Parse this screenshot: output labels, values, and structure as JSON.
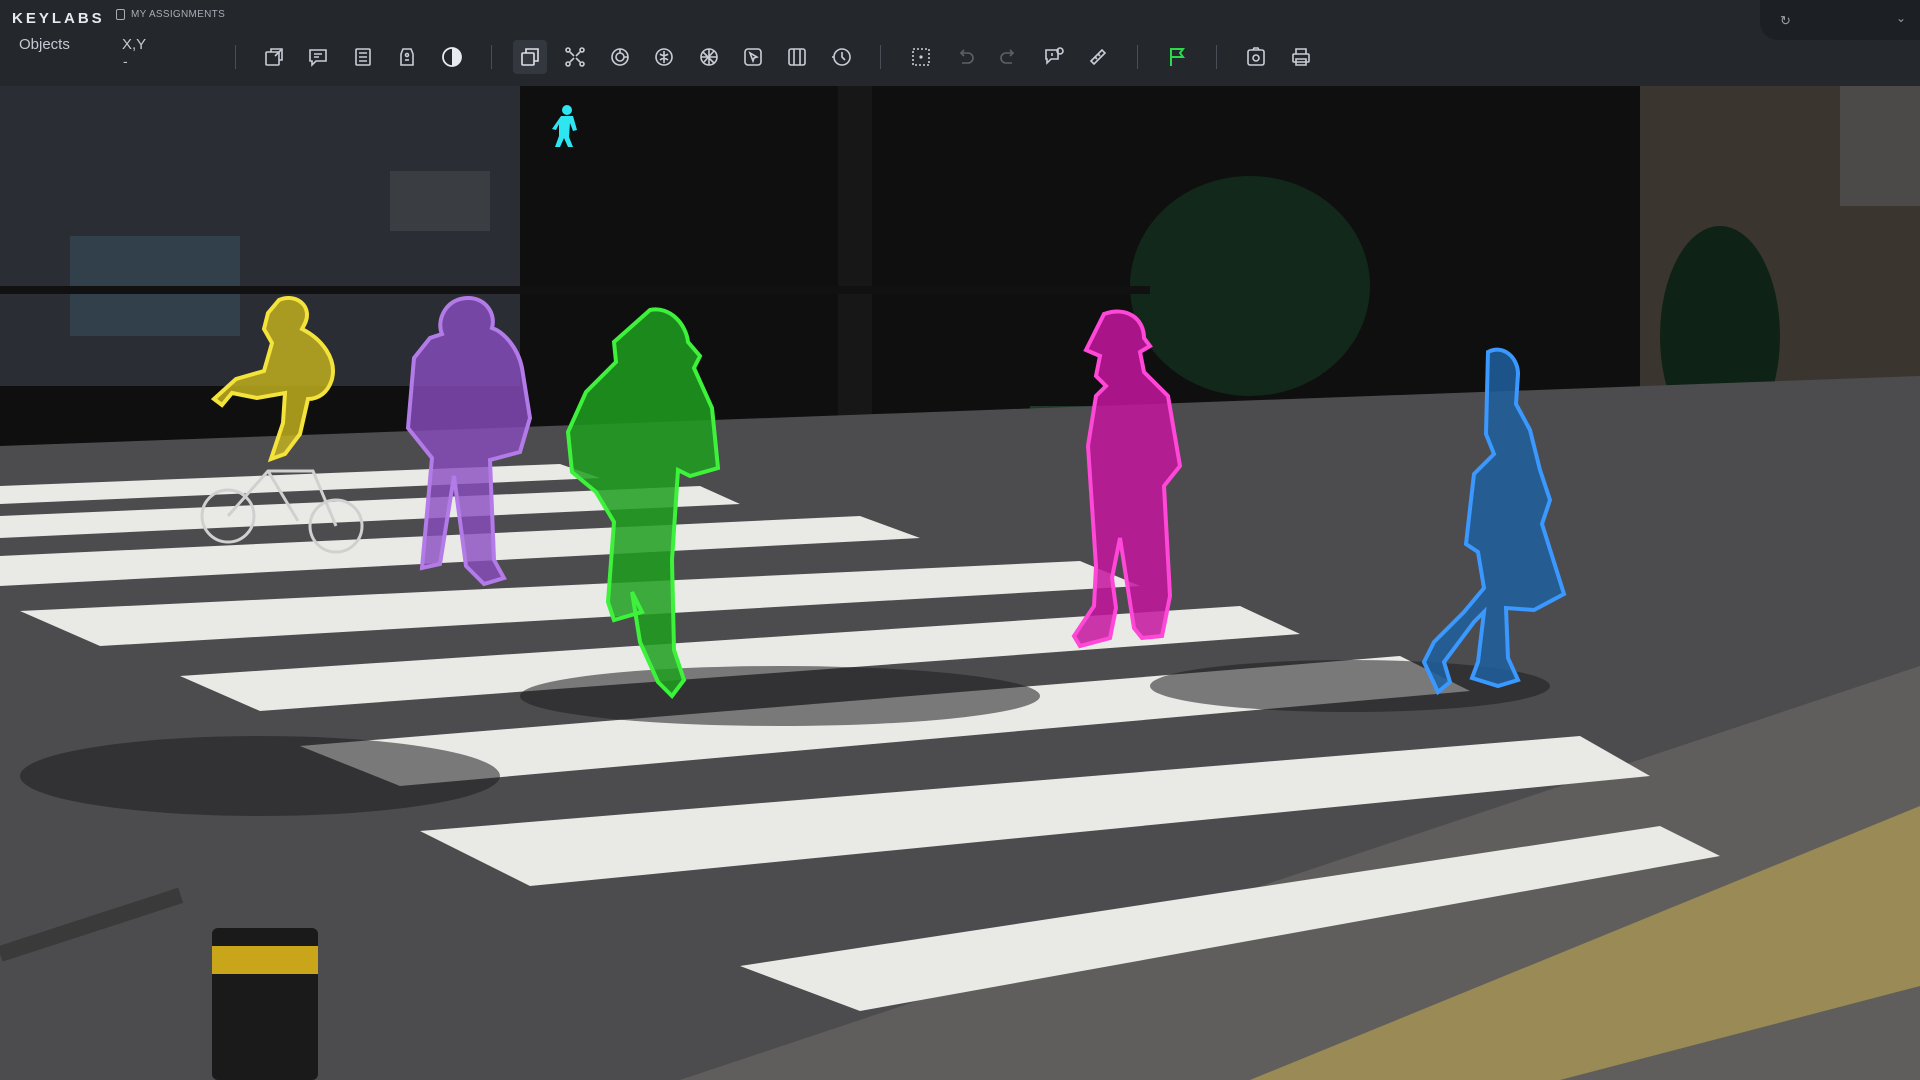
{
  "app": {
    "brand": "KEYLABS",
    "assignments_label": "MY ASSIGNMENTS"
  },
  "info": {
    "objects_label": "Objects",
    "xy_label": "X,Y",
    "xy_value": "-"
  },
  "toolbar": {
    "tools": [
      {
        "name": "export-icon",
        "active": false,
        "dim": false
      },
      {
        "name": "comments-icon",
        "active": false,
        "dim": false
      },
      {
        "name": "list-icon",
        "active": false,
        "dim": false
      },
      {
        "name": "tag-icon",
        "active": false,
        "dim": false
      },
      {
        "name": "contrast-icon",
        "active": false,
        "dim": false
      },
      {
        "name": "copy-frame-icon",
        "active": true,
        "dim": false
      },
      {
        "name": "keypoints-icon",
        "active": false,
        "dim": false
      },
      {
        "name": "auto-segment-icon",
        "active": false,
        "dim": false
      },
      {
        "name": "smart-brush-icon",
        "active": false,
        "dim": false
      },
      {
        "name": "mask-icon",
        "active": false,
        "dim": false
      },
      {
        "name": "cursor-box-icon",
        "active": false,
        "dim": false
      },
      {
        "name": "grid-icon",
        "active": false,
        "dim": false
      },
      {
        "name": "history-icon",
        "active": false,
        "dim": false
      },
      {
        "name": "select-area-icon",
        "active": false,
        "dim": false
      },
      {
        "name": "undo-icon",
        "active": false,
        "dim": true
      },
      {
        "name": "redo-icon",
        "active": false,
        "dim": true
      },
      {
        "name": "issue-icon",
        "active": false,
        "dim": false
      },
      {
        "name": "ruler-icon",
        "active": false,
        "dim": false
      },
      {
        "name": "flag-icon",
        "active": false,
        "dim": false
      },
      {
        "name": "screenshot-icon",
        "active": false,
        "dim": false
      },
      {
        "name": "print-icon",
        "active": false,
        "dim": false
      }
    ]
  },
  "colors": {
    "accent_flag": "#2bd94a",
    "cyclist": "#e6d22a",
    "woman_purple": "#9b59d0",
    "person_green": "#2bdc2a",
    "person_magenta": "#ff3ad0",
    "woman_blue": "#2f8cff"
  },
  "canvas": {
    "annotations": [
      {
        "label": "person-cyclist",
        "color": "#e6d22a"
      },
      {
        "label": "person-purple",
        "color": "#9b59d0"
      },
      {
        "label": "person-green",
        "color": "#2bdc2a"
      },
      {
        "label": "person-magenta",
        "color": "#ff3ad0"
      },
      {
        "label": "person-blue",
        "color": "#2f8cff"
      }
    ]
  }
}
